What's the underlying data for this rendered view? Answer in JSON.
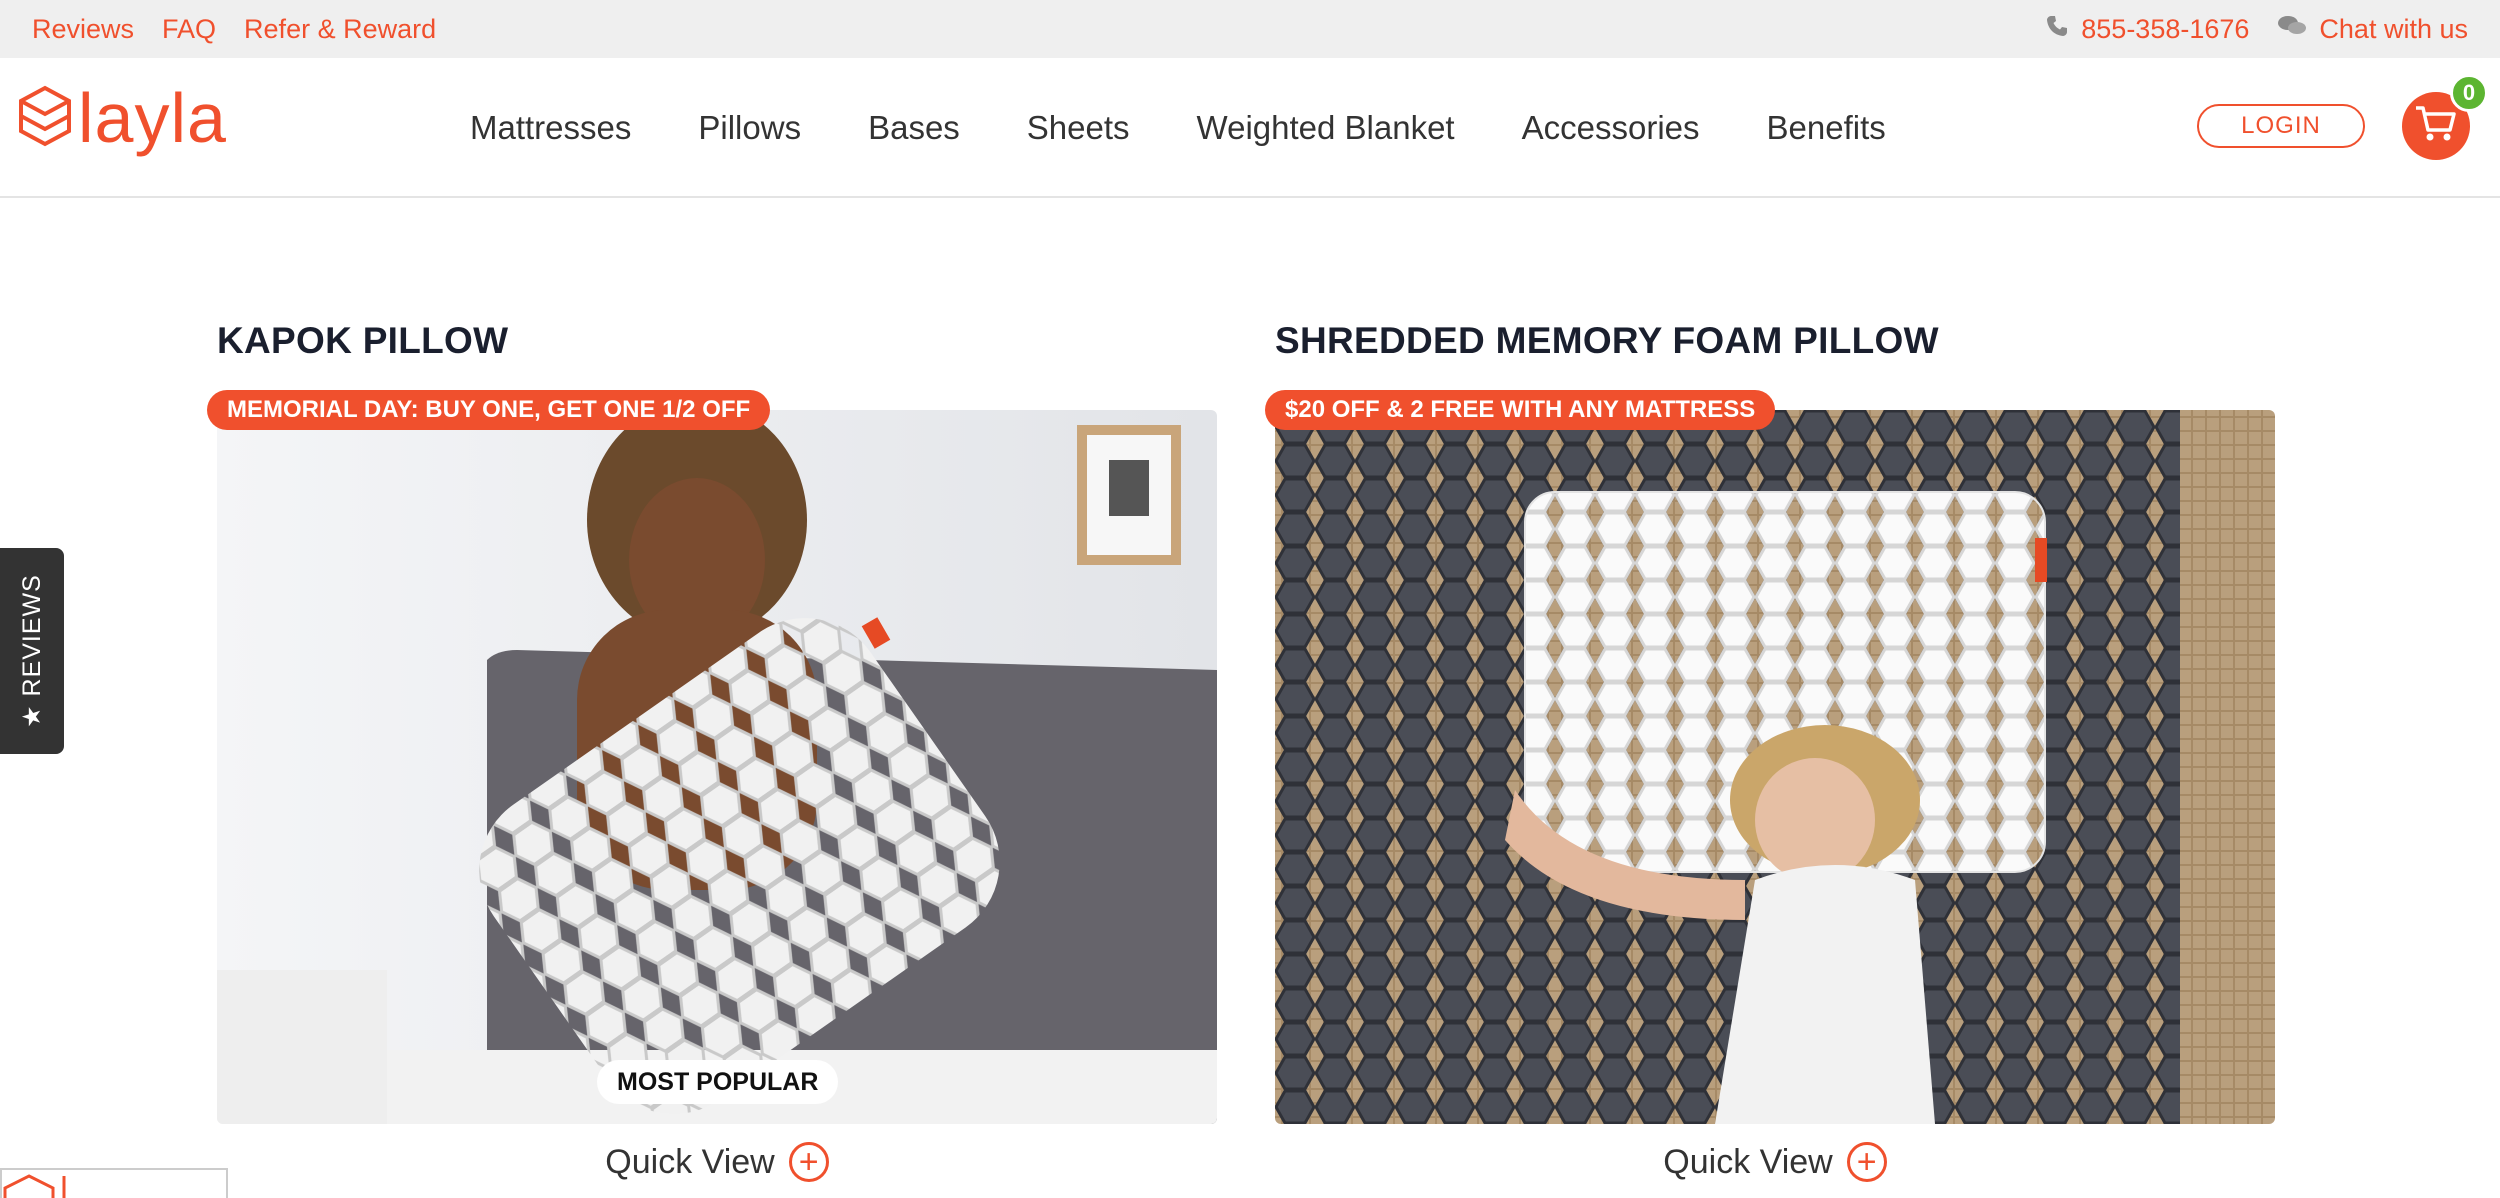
{
  "topbar": {
    "links": [
      "Reviews",
      "FAQ",
      "Refer & Reward"
    ],
    "phone": "855-358-1676",
    "chat": "Chat with us"
  },
  "header": {
    "logo": "layla",
    "nav": [
      "Mattresses",
      "Pillows",
      "Bases",
      "Sheets",
      "Weighted Blanket",
      "Accessories",
      "Benefits"
    ],
    "login": "LOGIN",
    "cart_count": "0"
  },
  "products": [
    {
      "title": "KAPOK PILLOW",
      "promo": "MEMORIAL DAY: BUY ONE, GET ONE 1/2 OFF",
      "badge": "MOST POPULAR",
      "quick_view": "Quick View"
    },
    {
      "title": "SHREDDED MEMORY FOAM PILLOW",
      "promo": "$20 OFF & 2 FREE WITH ANY MATTRESS",
      "quick_view": "Quick View"
    }
  ],
  "reviews_tab": "★ REVIEWS",
  "colors": {
    "accent": "#f0502d",
    "cart_badge": "#5cb531",
    "topbar_bg": "#efefef"
  }
}
